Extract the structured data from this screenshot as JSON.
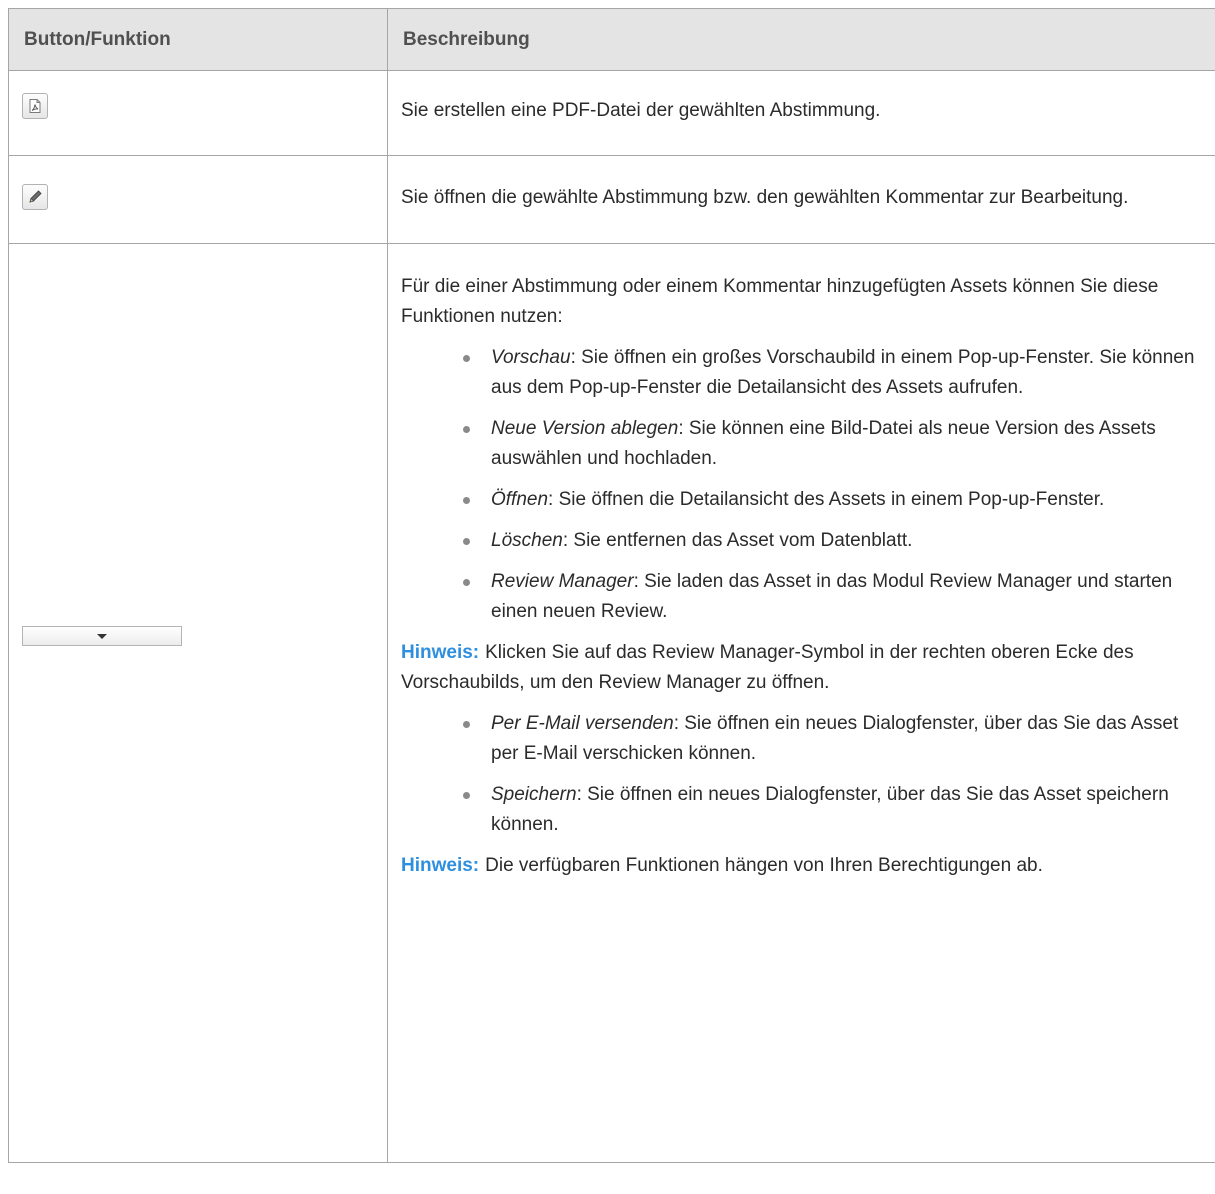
{
  "table": {
    "headers": [
      "Button/Funktion",
      "Beschreibung"
    ],
    "rows": {
      "pdf": {
        "icon": "pdf-icon",
        "description": "Sie erstellen eine PDF-Datei der gewählten Abstimmung."
      },
      "edit": {
        "icon": "pencil-icon",
        "description": "Sie öffnen die gewählte Abstimmung bzw. den gewählten Kommentar zur Bearbeitung."
      },
      "assets": {
        "icon": "dropdown-arrow-icon",
        "intro": "Für die einer Abstimmung oder einem Kommentar hinzugefügten Assets können Sie diese Funktionen nutzen:",
        "items": [
          {
            "name": "Vorschau",
            "text": ": Sie öffnen ein großes Vorschaubild in einem Pop-up-Fenster. Sie können aus dem Pop-up-Fenster die Detailansicht des Assets aufrufen."
          },
          {
            "name": "Neue Version ablegen",
            "text": ": Sie können eine Bild-Datei als neue Version des Assets auswählen und hochladen."
          },
          {
            "name": "Öffnen",
            "text": ": Sie öffnen die Detailansicht des Assets in einem Pop-up-Fenster."
          },
          {
            "name": "Löschen",
            "text": ": Sie entfernen das Asset vom Datenblatt."
          },
          {
            "name": "Review Manager",
            "text": ": Sie laden das Asset in das Modul Review Manager und starten einen neuen Review."
          }
        ],
        "note1": {
          "label": "Hinweis:",
          "text": "Klicken Sie auf das Review Manager-Symbol in der rechten oberen Ecke des Vorschaubilds, um den Review Manager zu öffnen."
        },
        "items2": [
          {
            "name": "Per E-Mail versenden",
            "text": ": Sie öffnen ein neues Dialogfenster, über das Sie das Asset per E-Mail verschicken können."
          },
          {
            "name": "Speichern",
            "text": ": Sie öffnen ein neues Dialogfenster, über das Sie das Asset speichern können."
          }
        ],
        "note2": {
          "label": "Hinweis:",
          "text": "Die verfügbaren Funktionen hängen von Ihren Berechtigungen ab."
        }
      }
    }
  },
  "colors": {
    "header_bg": "#e4e4e4",
    "border": "#a6a6a6",
    "note_label": "#2f8fdf",
    "text": "#2b2b2b"
  }
}
